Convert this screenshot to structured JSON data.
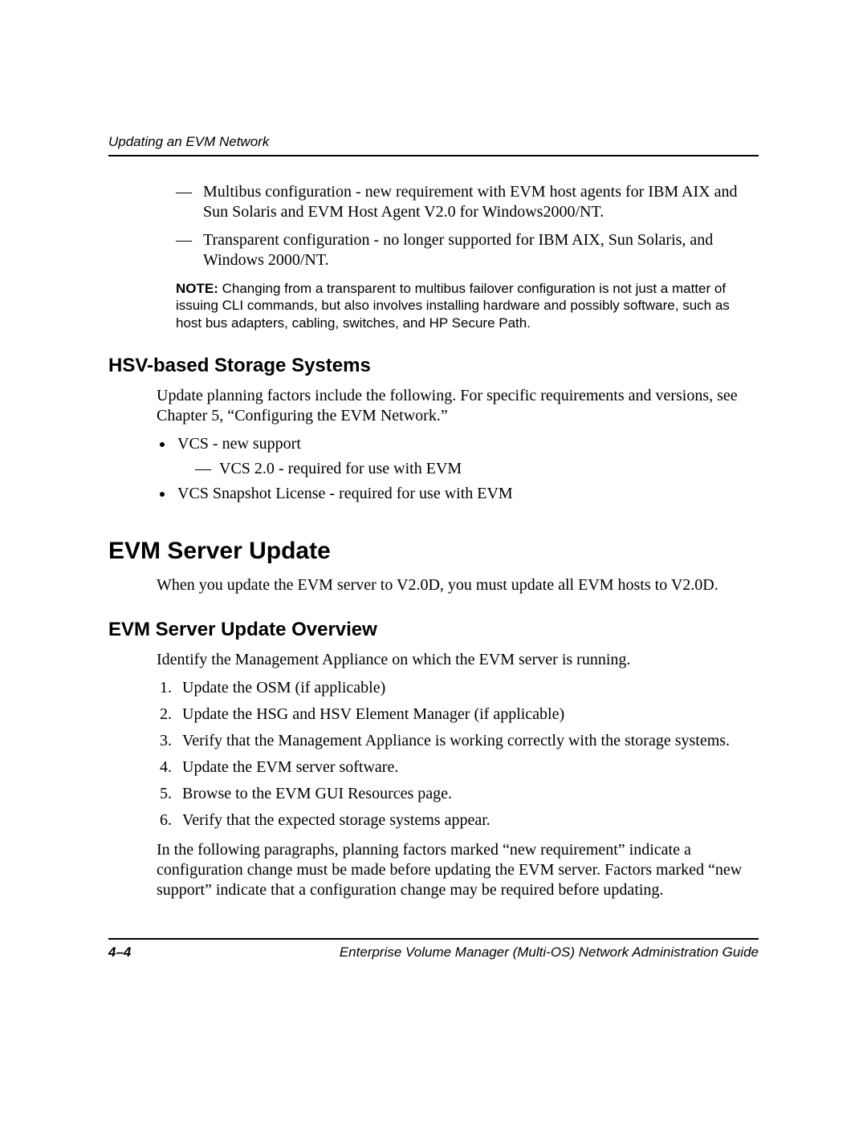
{
  "header": {
    "running_head": "Updating an EVM Network"
  },
  "intro_dash_items": [
    "Multibus configuration - new requirement with EVM host agents for IBM AIX and Sun Solaris and EVM Host Agent V2.0 for Windows2000/NT.",
    "Transparent configuration - no longer supported for IBM AIX, Sun Solaris, and Windows 2000/NT."
  ],
  "note": {
    "label": "NOTE:",
    "text": "Changing from a transparent to multibus failover configuration is not just a matter of issuing CLI commands, but also involves installing hardware and possibly software, such as host bus adapters, cabling, switches, and HP Secure Path."
  },
  "hsv": {
    "heading": "HSV-based Storage Systems",
    "intro": "Update planning factors include the following. For specific requirements and versions, see Chapter 5, “Configuring the EVM Network.”",
    "bullets": [
      {
        "text": "VCS - new support",
        "sub": [
          "VCS 2.0 - required for use with EVM"
        ]
      },
      {
        "text": "VCS Snapshot License - required for use with EVM",
        "sub": []
      }
    ]
  },
  "update": {
    "heading": "EVM Server Update",
    "intro": "When you update the EVM server to V2.0D, you must update all EVM hosts to V2.0D."
  },
  "overview": {
    "heading": "EVM Server Update Overview",
    "intro": "Identify the Management Appliance on which the EVM server is running.",
    "steps": [
      "Update the OSM (if applicable)",
      "Update the HSG and HSV Element Manager (if applicable)",
      "Verify that the Management Appliance is working correctly with the storage systems.",
      "Update the EVM server software.",
      "Browse to the EVM GUI Resources page.",
      "Verify that the expected storage systems appear."
    ],
    "closing": "In the following paragraphs, planning factors marked “new requirement” indicate a configuration change must be made before updating the EVM server. Factors marked “new support” indicate that a configuration change may be required before updating."
  },
  "footer": {
    "page": "4–4",
    "title": "Enterprise Volume Manager (Multi-OS) Network Administration Guide"
  }
}
